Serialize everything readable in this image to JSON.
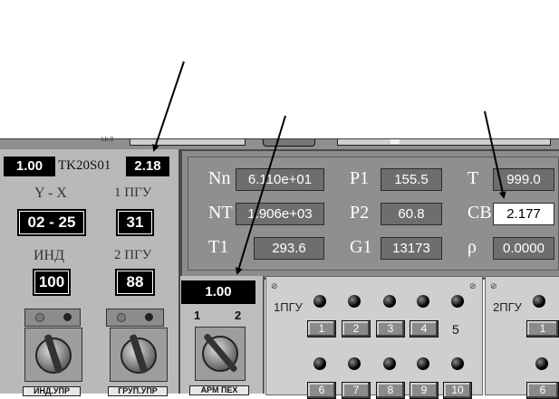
{
  "toolbar": {
    "small_label": "Lk.0"
  },
  "left": {
    "top_value": "1.00",
    "unit_code": "TK20S01",
    "top_value2": "2.18",
    "yx_label": "Y - X",
    "pgu1_label": "1 ПГУ",
    "yx_value": "02 - 25",
    "pgu1_value": "31",
    "ind_label": "ИНД",
    "pgu2_label": "2 ПГУ",
    "ind_value": "100",
    "pgu2_value": "88",
    "plate1": "ИНД.УПР",
    "plate2": "ГРУП.УПР"
  },
  "data_panel": {
    "rows": [
      {
        "l1": "Nn",
        "v1": "6.110e+01",
        "l2": "P1",
        "v2": "155.5",
        "l3": "T",
        "v3": "999.0"
      },
      {
        "l1": "NT",
        "v1": "1.906e+03",
        "l2": "P2",
        "v2": "60.8",
        "l3": "CB",
        "v3": "2.177"
      },
      {
        "l1": "T1",
        "v1": "293.6",
        "l2": "G1",
        "v2": "13173",
        "l3": "ρ",
        "v3": "0.0000"
      }
    ]
  },
  "arm": {
    "value": "1.00",
    "pos1": "1",
    "pos2": "2",
    "plate": "АРМ ПЕХ"
  },
  "pgu1": {
    "label": "1ПГУ",
    "buttons_row1": [
      "1",
      "2",
      "3",
      "4"
    ],
    "extra_label": "5",
    "buttons_row2": [
      "6",
      "7",
      "8",
      "9",
      "10"
    ]
  },
  "pgu2": {
    "label": "2ПГУ",
    "button_row1": "1",
    "button_row2": "6"
  }
}
